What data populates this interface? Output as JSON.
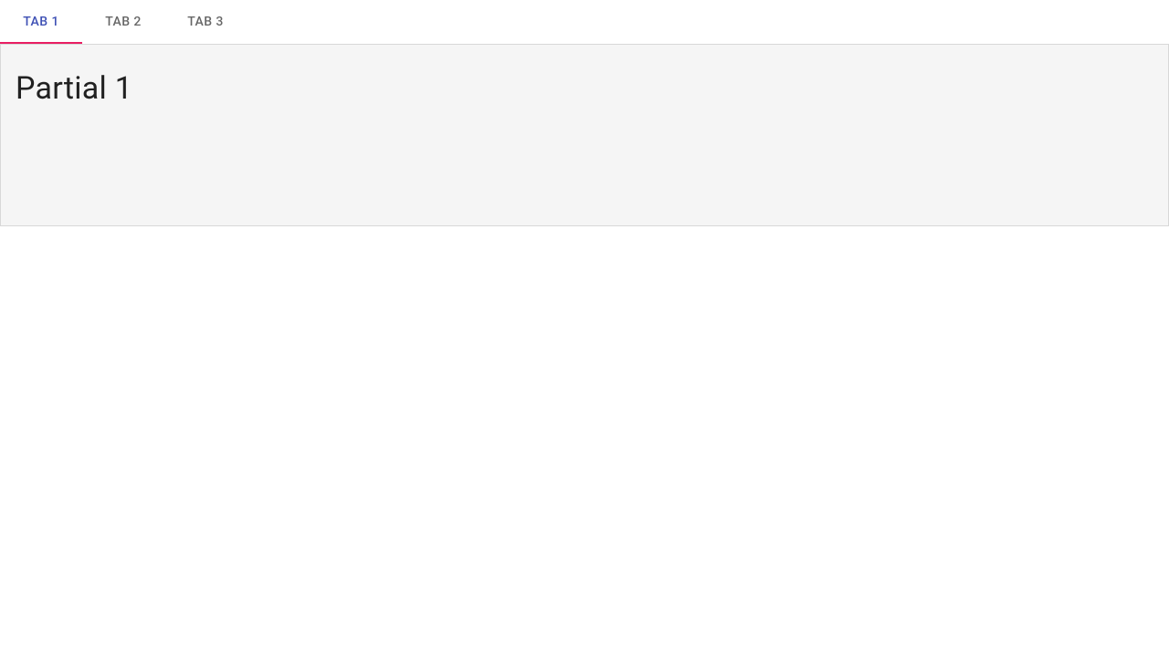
{
  "tabs": {
    "items": [
      {
        "label": "Tab 1",
        "active": true
      },
      {
        "label": "Tab 2",
        "active": false
      },
      {
        "label": "Tab 3",
        "active": false
      }
    ]
  },
  "content": {
    "heading": "Partial 1"
  },
  "colors": {
    "tab_active_text": "#3f51b5",
    "tab_inactive_text": "rgba(0,0,0,0.6)",
    "indicator": "#e91e63",
    "panel_bg": "#f5f5f5",
    "panel_border": "#d8d8d8"
  }
}
